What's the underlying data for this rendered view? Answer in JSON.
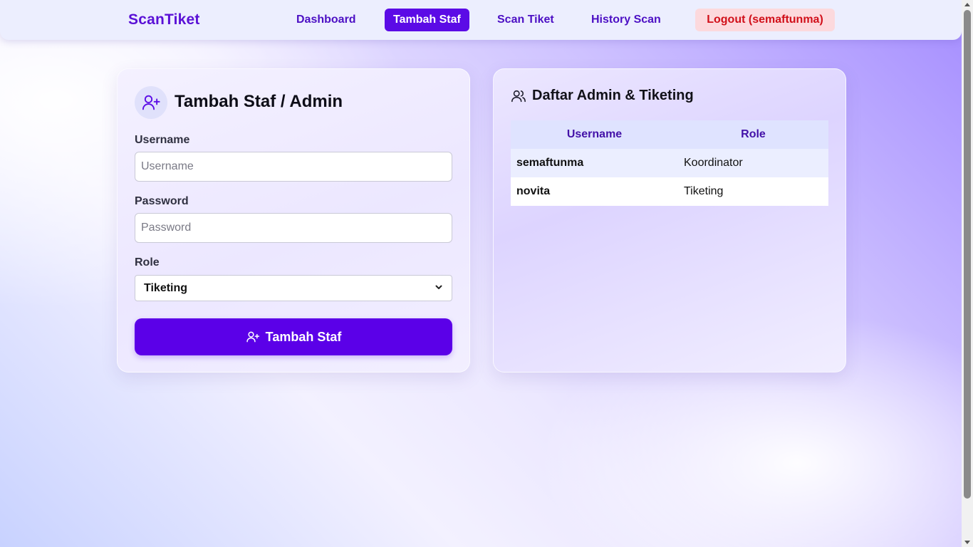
{
  "navbar": {
    "brand": "ScanTiket",
    "links": [
      {
        "label": "Dashboard"
      },
      {
        "label": "Tambah Staf"
      },
      {
        "label": "Scan Tiket"
      },
      {
        "label": "History Scan"
      }
    ],
    "logout_label": "Logout (semaftunma)"
  },
  "form": {
    "title": "Tambah Staf / Admin",
    "icon": "user-plus-icon",
    "username_label": "Username",
    "username_placeholder": "Username",
    "username_value": "",
    "password_label": "Password",
    "password_placeholder": "Password",
    "password_value": "",
    "role_label": "Role",
    "role_selected": "Tiketing",
    "submit_label": "Tambah Staf"
  },
  "staff_list": {
    "title": "Daftar Admin & Tiketing",
    "icon": "users-icon",
    "columns": [
      "Username",
      "Role"
    ],
    "rows": [
      {
        "username": "semaftunma",
        "role": "Koordinator"
      },
      {
        "username": "novita",
        "role": "Tiketing"
      }
    ]
  },
  "colors": {
    "accent": "#5b00e8",
    "brand": "#5a10d6",
    "logout_bg": "#fcd9dd",
    "logout_text": "#d1101a"
  }
}
